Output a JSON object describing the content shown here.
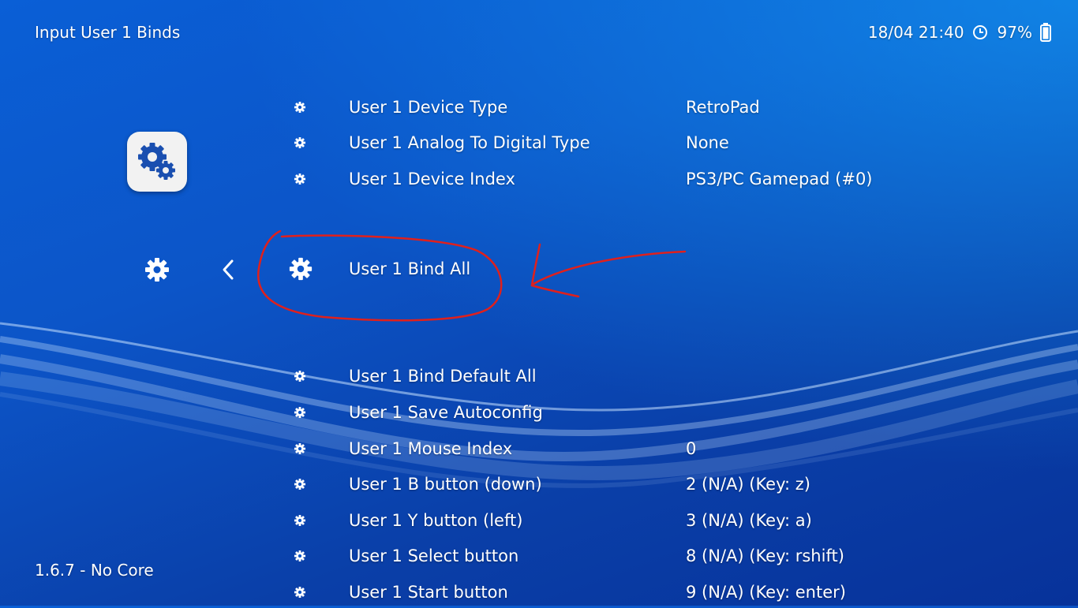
{
  "header": {
    "title": "Input User 1 Binds",
    "datetime": "18/04 21:40",
    "battery": "97%",
    "clock_icon": "clock-icon",
    "battery_icon": "battery-icon"
  },
  "footer": {
    "version": "1.6.7 - No Core"
  },
  "sidebar": {
    "tab_icon": "settings-gears-icon",
    "current_tab_icon": "gear-icon",
    "back_icon": "chevron-left-icon"
  },
  "menu": {
    "items": [
      {
        "label": "User 1 Device Type",
        "value": "RetroPad"
      },
      {
        "label": "User 1 Analog To Digital Type",
        "value": "None"
      },
      {
        "label": "User 1 Device Index",
        "value": "PS3/PC Gamepad (#0)"
      },
      {
        "label": "User 1 Bind All",
        "value": "",
        "selected": true
      },
      {
        "label": "User 1 Bind Default All",
        "value": ""
      },
      {
        "label": "User 1 Save Autoconfig",
        "value": ""
      },
      {
        "label": "User 1 Mouse Index",
        "value": "0"
      },
      {
        "label": "User 1 B button (down)",
        "value": "2 (N/A) (Key: z)"
      },
      {
        "label": "User 1 Y button (left)",
        "value": "3 (N/A) (Key: a)"
      },
      {
        "label": "User 1 Select button",
        "value": "8 (N/A) (Key: rshift)"
      },
      {
        "label": "User 1 Start button",
        "value": "9 (N/A) (Key: enter)"
      }
    ]
  },
  "colors": {
    "background": "#0c55c8",
    "text": "#ffffff",
    "annotation": "#e0201c"
  }
}
